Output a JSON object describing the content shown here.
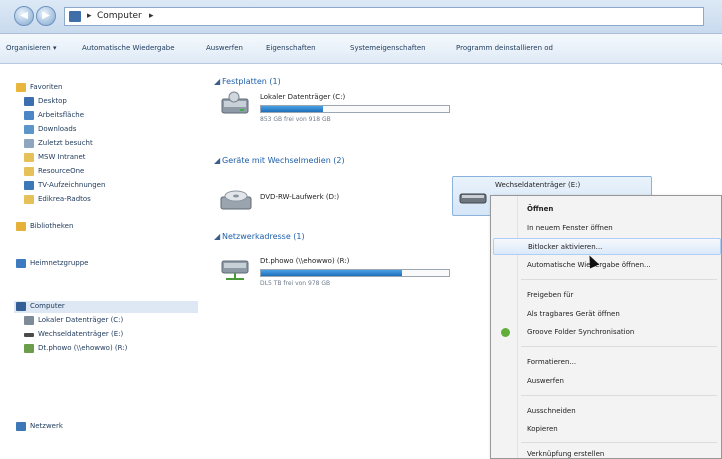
{
  "address": {
    "location": "Computer",
    "separator": "▸"
  },
  "toolbar": {
    "items": [
      "Organisieren ▾",
      "Automatische Wiedergabe",
      "Auswerfen",
      "Eigenschaften",
      "Systemeigenschaften",
      "Programm deinstallieren od"
    ]
  },
  "nav": {
    "items": [
      {
        "label": "Favoriten",
        "icon": "star-icon",
        "color": "#e8b63c"
      },
      {
        "label": "Desktop",
        "icon": "desktop-icon",
        "color": "#3d6fb0"
      },
      {
        "label": "Arbeitsfläche",
        "icon": "folder-icon",
        "color": "#4d86c6"
      },
      {
        "label": "Downloads",
        "icon": "download-icon",
        "color": "#5c95c9"
      },
      {
        "label": "Zuletzt besucht",
        "icon": "recent-icon",
        "color": "#8fa6c1"
      },
      {
        "label": "MSW Intranet",
        "icon": "folder-icon",
        "color": "#e6c15a"
      },
      {
        "label": "ResourceOne",
        "icon": "folder-icon",
        "color": "#e6c15a"
      },
      {
        "label": "TV-Aufzeichnungen",
        "icon": "tv-icon",
        "color": "#3c77b8"
      },
      {
        "label": "Edikrea-Radtos",
        "icon": "folder-icon",
        "color": "#e6c15a"
      },
      {
        "label": "Bibliotheken",
        "icon": "library-icon",
        "color": "#e6b13a"
      },
      {
        "label": "Heimnetzgruppe",
        "icon": "homegroup-icon",
        "color": "#3c7bc0"
      },
      {
        "label": "Computer",
        "icon": "computer-icon",
        "color": "#345f96"
      },
      {
        "label": "Lokaler Datenträger (C:)",
        "icon": "drive-icon",
        "color": "#7d8b99"
      },
      {
        "label": "Wechseldatenträger (E:)",
        "icon": "usb-drive-icon",
        "color": "#4a4a4a"
      },
      {
        "label": "Dt.phowo (\\\\ehowwo) (R:)",
        "icon": "network-drive-icon",
        "color": "#6a9e4a"
      },
      {
        "label": "Netzwerk",
        "icon": "network-icon",
        "color": "#3c77b8"
      }
    ]
  },
  "content": {
    "groups": [
      {
        "title": "Festplatten (1)"
      },
      {
        "title": "Geräte mit Wechselmedien (2)"
      },
      {
        "title": "Netzwerkadresse (1)"
      }
    ],
    "drives": [
      {
        "name": "Lokaler Datenträger (C:)",
        "free": "853 GB frei von 918 GB",
        "used_fraction": 0.33
      },
      {
        "name": "DVD-RW-Laufwerk (D:)"
      },
      {
        "name": "Wechseldatenträger (E:)"
      },
      {
        "name": "Dt.phowo (\\\\ehowwo) (R:)",
        "free": "DL5 TB frei von 978 GB",
        "used_fraction": 0.75
      }
    ]
  },
  "context_menu": {
    "items": [
      "Öffnen",
      "In neuem Fenster öffnen",
      "Bitlocker aktivieren...",
      "Automatische Wiedergabe öffnen...",
      "Freigeben für",
      "Als tragbares Gerät öffnen",
      "Groove Folder Synchronisation",
      "Formatieren...",
      "Auswerfen",
      "Ausschneiden",
      "Kopieren",
      "Verknüpfung erstellen"
    ]
  }
}
